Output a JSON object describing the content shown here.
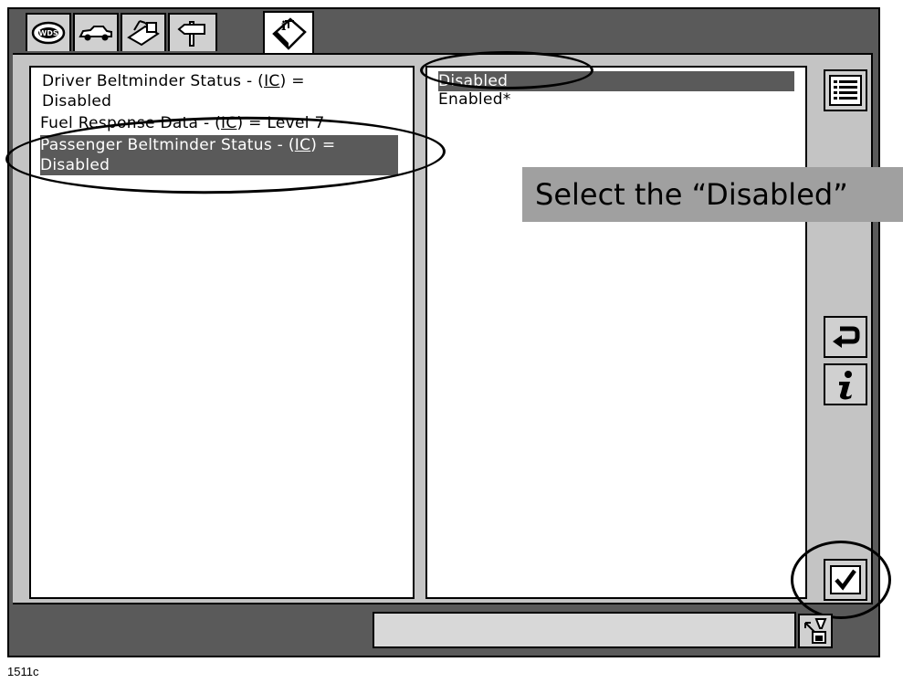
{
  "tabs": [
    {
      "name": "wds-tab",
      "icon": "wds-logo-icon"
    },
    {
      "name": "vehicle-tab",
      "icon": "car-icon"
    },
    {
      "name": "toolbox-tab",
      "icon": "toolbox-icon"
    },
    {
      "name": "signpost-tab",
      "icon": "signpost-icon"
    },
    {
      "name": "info-tab",
      "icon": "info-book-icon",
      "active": true
    }
  ],
  "left_list": {
    "items": [
      {
        "parts": [
          "Driver Beltminder Status   - (",
          "IC",
          ")  ="
        ],
        "line2": "Disabled",
        "selected": false
      },
      {
        "parts": [
          "Fuel Response Data  -  (",
          "IC",
          ")   =  Level 7"
        ],
        "selected": false
      },
      {
        "parts": [
          "Passenger Beltminder Status  -  (",
          "IC",
          ")  ="
        ],
        "line2": "Disabled",
        "selected": true
      }
    ]
  },
  "right_list": {
    "items": [
      {
        "label": "Disabled",
        "selected": true
      },
      {
        "label": "Enabled*",
        "selected": false
      }
    ]
  },
  "callout": {
    "text": "Select the “Disabled”"
  },
  "side_buttons": [
    {
      "name": "list-button",
      "icon": "list-icon"
    },
    {
      "name": "back-button",
      "icon": "return-arrow-icon"
    },
    {
      "name": "info-button",
      "icon": "info-i-icon"
    },
    {
      "name": "confirm-button",
      "icon": "checkmark-icon"
    }
  ],
  "status_bar": {
    "field_value": "",
    "button_icon": "tool-icon"
  },
  "caption": "1511c"
}
